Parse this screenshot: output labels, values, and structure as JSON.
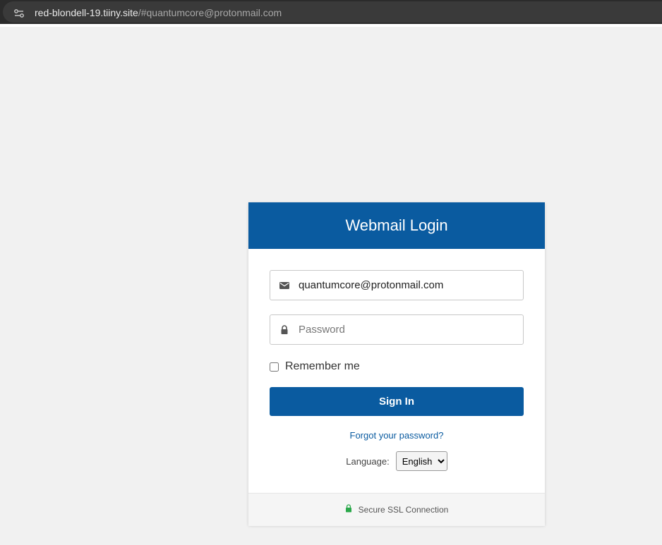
{
  "browser": {
    "url_host": "red-blondell-19.tiiny.site",
    "url_rest": "/#quantumcore@protonmail.com",
    "site_icon": "tune-icon"
  },
  "login": {
    "title": "Webmail Login",
    "email_value": "quantumcore@protonmail.com",
    "email_icon": "envelope-icon",
    "password_placeholder": "Password",
    "password_icon": "lock-icon",
    "remember_label": "Remember me",
    "remember_checked": false,
    "sign_in_label": "Sign In",
    "forgot_label": "Forgot your password?",
    "language_label": "Language:",
    "language_selected": "English",
    "footer_text": "Secure SSL Connection",
    "footer_icon": "lock-icon"
  },
  "colors": {
    "primary": "#0a5ba0",
    "secure_green": "#2aa84a",
    "page_bg": "#f1f1f1"
  }
}
